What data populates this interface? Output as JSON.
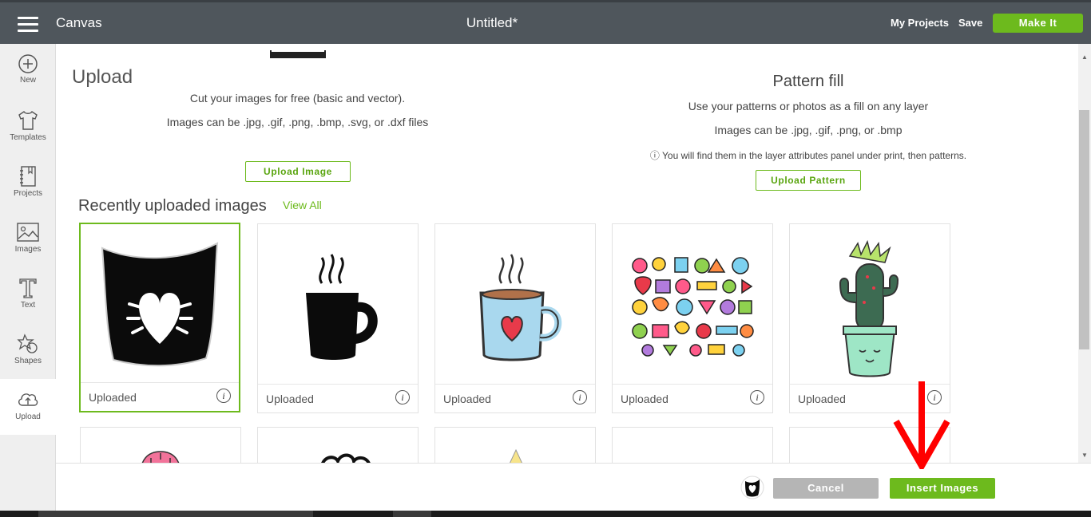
{
  "topbar": {
    "app_title": "Canvas",
    "doc_title": "Untitled*",
    "my_projects": "My Projects",
    "save": "Save",
    "make_it": "Make It"
  },
  "sidebar": {
    "items": [
      {
        "label": "New",
        "icon": "plus-circle-icon"
      },
      {
        "label": "Templates",
        "icon": "tshirt-icon"
      },
      {
        "label": "Projects",
        "icon": "notebook-icon"
      },
      {
        "label": "Images",
        "icon": "image-icon"
      },
      {
        "label": "Text",
        "icon": "text-t-icon"
      },
      {
        "label": "Shapes",
        "icon": "shapes-icon"
      },
      {
        "label": "Upload",
        "icon": "cloud-upload-icon"
      }
    ],
    "active": "Upload"
  },
  "upload": {
    "heading": "Upload",
    "desc1": "Cut your images for free (basic and vector).",
    "desc2": "Images can be .jpg, .gif, .png, .bmp, .svg, or .dxf files",
    "button": "Upload Image"
  },
  "pattern": {
    "heading": "Pattern fill",
    "desc1": "Use your patterns or photos as a fill on any layer",
    "desc2": "Images can be .jpg, .gif, .png, or .bmp",
    "note": "ⓘ You will find them in the layer attributes panel under print, then patterns.",
    "button": "Upload Pattern"
  },
  "recent": {
    "heading": "Recently uploaded images",
    "view_all": "View All",
    "cards": [
      {
        "caption": "Uploaded",
        "image": "black-heart-bag",
        "selected": true
      },
      {
        "caption": "Uploaded",
        "image": "black-coffee-mug",
        "selected": false
      },
      {
        "caption": "Uploaded",
        "image": "blue-coffee-mug-heart",
        "selected": false
      },
      {
        "caption": "Uploaded",
        "image": "doodle-sticker-sheet",
        "selected": false
      },
      {
        "caption": "Uploaded",
        "image": "cactus-in-pot",
        "selected": false
      }
    ],
    "info_glyph": "i"
  },
  "footer": {
    "cancel": "Cancel",
    "insert": "Insert Images"
  },
  "annotation": {
    "arrow_color": "#ff0000"
  },
  "colors": {
    "accent": "#6dba1d",
    "topbar": "#4f565c"
  }
}
